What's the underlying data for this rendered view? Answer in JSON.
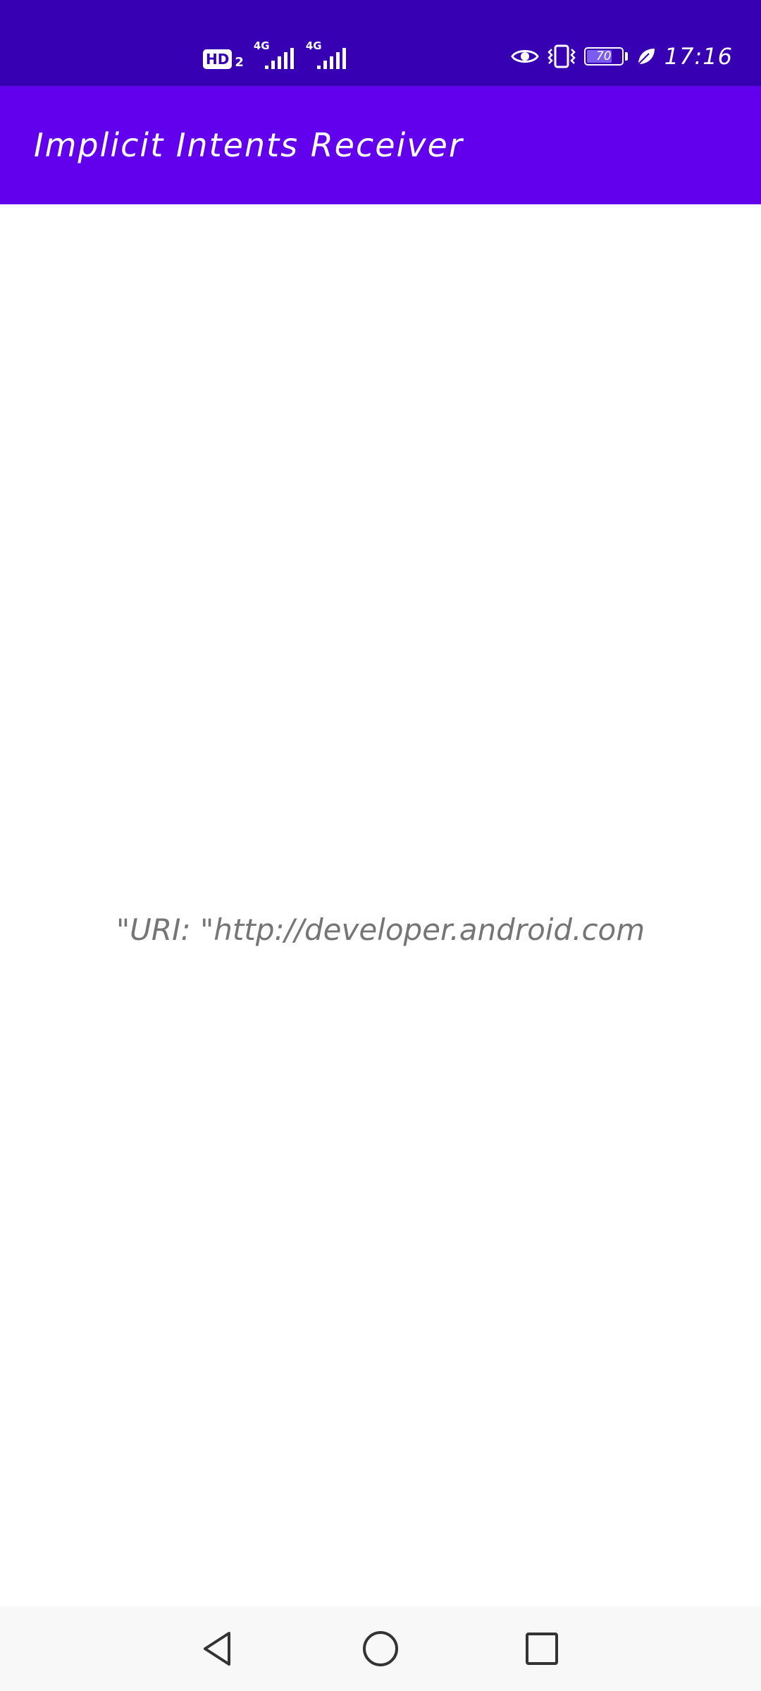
{
  "status_bar": {
    "hd_label": "HD",
    "hd_sub": "2",
    "signal_1_network": "4G",
    "signal_2_network": "4G",
    "battery_level": "70",
    "time": "17:16",
    "icons": [
      "eye-icon",
      "vibrate-icon",
      "battery-icon",
      "leaf-icon",
      "signal-icon"
    ]
  },
  "app_bar": {
    "title": "Implicit Intents Receiver"
  },
  "content": {
    "uri_text": "\"URI: \"http://developer.android.com"
  },
  "nav_bar": {
    "buttons": [
      "back",
      "home",
      "recents"
    ]
  },
  "colors": {
    "status_bar": "#3700b3",
    "app_bar": "#6200ee",
    "text": "#757575",
    "nav_bar": "#f8f8f8"
  }
}
